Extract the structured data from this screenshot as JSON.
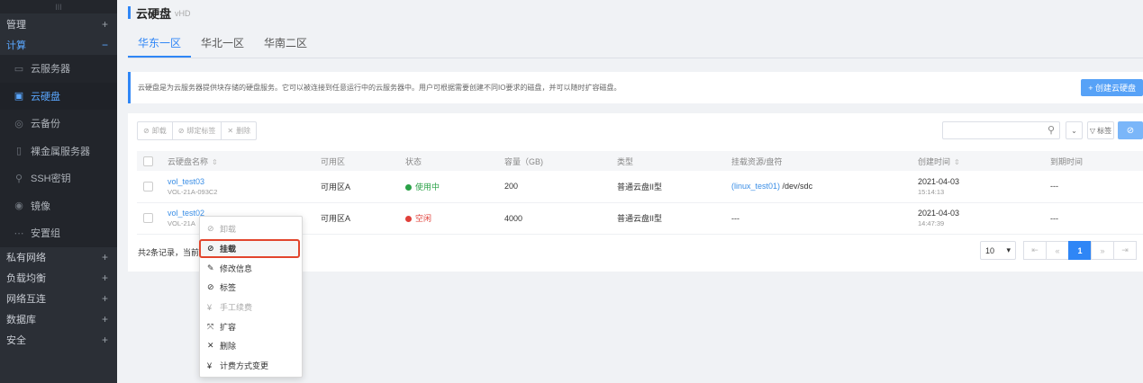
{
  "sidebar": {
    "top_glyph": "III",
    "groups": [
      {
        "label": "管理",
        "sign": "+"
      },
      {
        "label": "计算",
        "sign": "−"
      }
    ],
    "items": [
      {
        "label": "云服务器",
        "icon": "server-icon"
      },
      {
        "label": "云硬盘",
        "icon": "disk-icon"
      },
      {
        "label": "云备份",
        "icon": "backup-icon"
      },
      {
        "label": "裸金属服务器",
        "icon": "bare-metal-icon"
      },
      {
        "label": "SSH密钥",
        "icon": "key-icon"
      },
      {
        "label": "镜像",
        "icon": "image-icon"
      },
      {
        "label": "安置组",
        "icon": "placement-icon"
      }
    ],
    "lower_groups": [
      {
        "label": "私有网络",
        "sign": "+"
      },
      {
        "label": "负载均衡",
        "sign": "+"
      },
      {
        "label": "网络互连",
        "sign": "+"
      },
      {
        "label": "数据库",
        "sign": "+"
      },
      {
        "label": "安全",
        "sign": "+"
      }
    ]
  },
  "page": {
    "title": "云硬盘",
    "subtitle": "vHD"
  },
  "tabs": [
    "华东一区",
    "华北一区",
    "华南二区"
  ],
  "info_text": "云硬盘是为云服务器提供块存储的硬盘服务。它可以被连接到任意运行中的云服务器中。用户可根据需要创建不同IO要求的磁盘，并可以随时扩容磁盘。",
  "create_button": "+ 创建云硬盘",
  "toolbar": {
    "unmount": "卸载",
    "bind_tag": "绑定标签",
    "delete": "删除",
    "tag": "标签"
  },
  "table": {
    "headers": [
      "云硬盘名称",
      "可用区",
      "状态",
      "容量（GB)",
      "类型",
      "挂载资源/盘符",
      "创建时间",
      "到期时间"
    ],
    "rows": [
      {
        "name": "vol_test03",
        "id": "VOL-21A-093C2",
        "zone": "可用区A",
        "status": "使用中",
        "status_color": "#2aa147",
        "capacity": "200",
        "type": "普通云盘II型",
        "mount_link": "(linux_test01)",
        "mount_path": "/dev/sdc",
        "created_date": "2021-04-03",
        "created_time": "15:14:13",
        "expire": "---"
      },
      {
        "name": "vol_test02",
        "id": "VOL-21A",
        "zone": "可用区A",
        "status": "空闲",
        "status_color": "#e0403a",
        "capacity": "4000",
        "type": "普通云盘II型",
        "mount_link": "",
        "mount_path": "---",
        "created_date": "2021-04-03",
        "created_time": "14:47:39",
        "expire": "---"
      }
    ]
  },
  "summary": "共2条记录，当前",
  "pager": {
    "page_size": "10",
    "current": "1"
  },
  "context_menu": [
    {
      "label": "卸载",
      "icon": "link-icon",
      "disabled": true
    },
    {
      "label": "挂载",
      "icon": "link-icon",
      "disabled": false,
      "highlight": true
    },
    {
      "label": "修改信息",
      "icon": "edit-icon",
      "disabled": false
    },
    {
      "label": "标签",
      "icon": "tag-icon",
      "disabled": false
    },
    {
      "label": "手工续费",
      "icon": "yen-icon",
      "disabled": true
    },
    {
      "label": "扩容",
      "icon": "expand-icon",
      "disabled": false
    },
    {
      "label": "删除",
      "icon": "close-icon",
      "disabled": false
    },
    {
      "label": "计费方式变更",
      "icon": "yen-icon",
      "disabled": false
    }
  ]
}
